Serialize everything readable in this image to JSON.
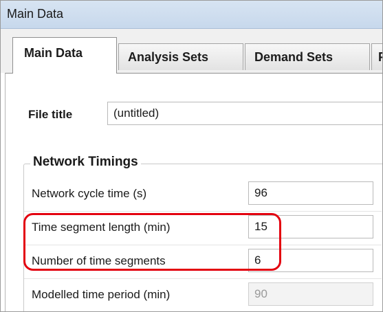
{
  "window": {
    "title": "Main Data"
  },
  "tabs": [
    {
      "label": "Main Data",
      "active": true
    },
    {
      "label": "Analysis Sets",
      "active": false
    },
    {
      "label": "Demand Sets",
      "active": false
    },
    {
      "label": "F",
      "active": false
    }
  ],
  "file": {
    "label": "File title",
    "value": "(untitled)"
  },
  "network_timings": {
    "heading": "Network Timings",
    "rows": [
      {
        "label": "Network cycle time (s)",
        "value": "96",
        "enabled": true
      },
      {
        "label": "Time segment length (min)",
        "value": "15",
        "enabled": true
      },
      {
        "label": "Number of time segments",
        "value": "6",
        "enabled": true
      },
      {
        "label": "Modelled time period (min)",
        "value": "90",
        "enabled": false
      }
    ]
  },
  "annotation": {
    "highlight_color": "#e3000f"
  }
}
